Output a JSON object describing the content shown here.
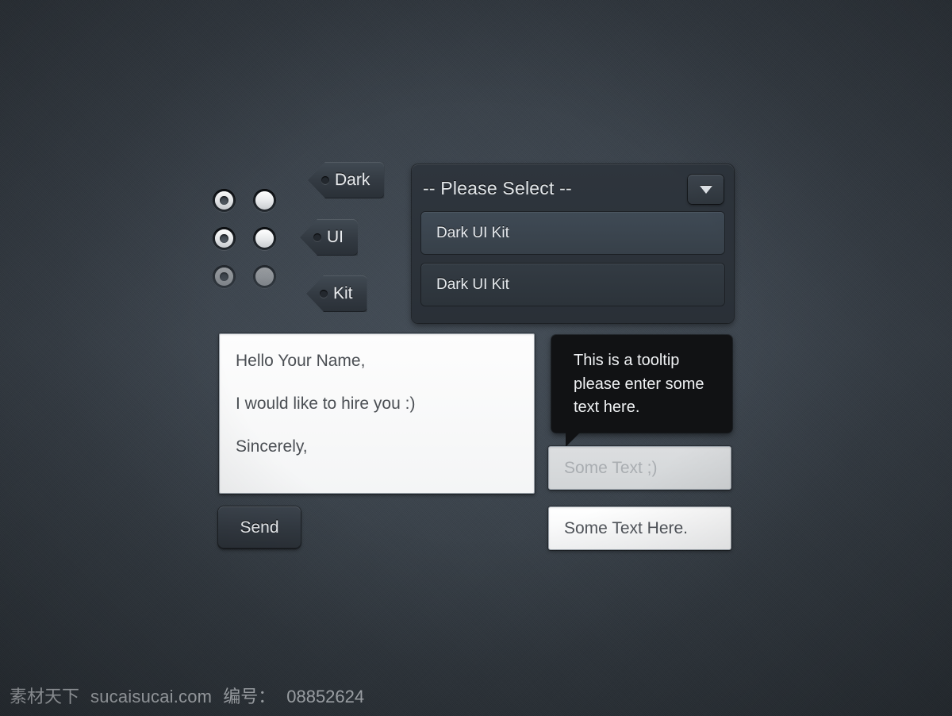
{
  "theme": {
    "background": "#343b43",
    "panel": "#2e353d",
    "option_selected": "#3f4a55",
    "option_plain": "#333b43",
    "tooltip_bg": "#111214",
    "text_light": "#e6eaee",
    "text_dark": "#4b4f54"
  },
  "radios": {
    "rows": [
      {
        "left_label": "radio-checked",
        "left_checked": true,
        "right_label": "radio-unchecked",
        "right_checked": false,
        "disabled": false
      },
      {
        "left_label": "radio-checked",
        "left_checked": true,
        "right_label": "radio-unchecked",
        "right_checked": false,
        "disabled": false
      },
      {
        "left_label": "radio-checked-disabled",
        "left_checked": true,
        "right_label": "radio-unchecked-disabled",
        "right_checked": false,
        "disabled": true
      }
    ]
  },
  "tags": [
    {
      "label": "Dark"
    },
    {
      "label": "UI"
    },
    {
      "label": "Kit"
    }
  ],
  "select": {
    "selected_label": "-- Please Select --",
    "arrow_icon": "chevron-down-icon",
    "options": [
      {
        "label": "Dark UI Kit",
        "selected": true
      },
      {
        "label": "Dark UI Kit",
        "selected": false
      }
    ]
  },
  "textarea": {
    "lines": [
      "Hello Your Name,",
      "I would like to hire you :)",
      "Sincerely,"
    ]
  },
  "send_button": {
    "label": "Send"
  },
  "tooltip": {
    "text": "This is a tooltip please enter some text here."
  },
  "inputs": {
    "placeholder_field": {
      "placeholder": "Some Text ;)",
      "value": ""
    },
    "filled_field": {
      "value": "Some Text Here.",
      "placeholder": "Some Text Here."
    }
  },
  "watermark": {
    "brand": "素材天下",
    "site": "sucaisucai.com",
    "id_label": "编号：",
    "id_value": "08852624"
  }
}
